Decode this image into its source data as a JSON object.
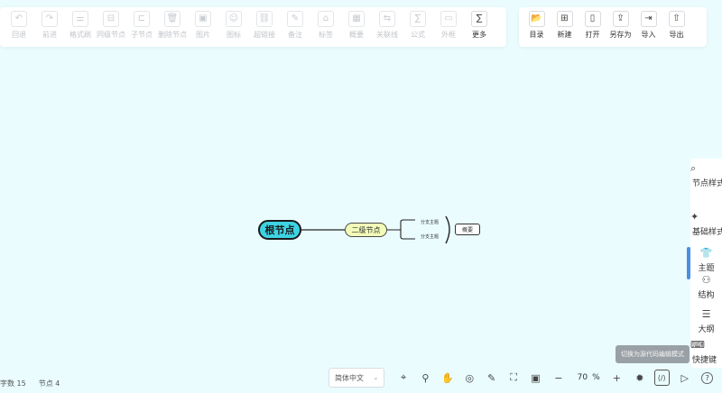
{
  "toolbar_left": [
    {
      "name": "undo",
      "label": "回退",
      "icon": "↶",
      "enabled": false
    },
    {
      "name": "redo",
      "label": "前进",
      "icon": "↷",
      "enabled": false
    },
    {
      "name": "format-painter",
      "label": "格式刷",
      "icon": "⚌",
      "enabled": false
    },
    {
      "name": "sibling-node",
      "label": "同级节点",
      "icon": "⊟",
      "enabled": false
    },
    {
      "name": "child-node",
      "label": "子节点",
      "icon": "⊏",
      "enabled": false
    },
    {
      "name": "delete-node",
      "label": "删除节点",
      "icon": "🗑",
      "enabled": false
    },
    {
      "name": "image",
      "label": "图片",
      "icon": "▣",
      "enabled": false
    },
    {
      "name": "icon",
      "label": "图标",
      "icon": "☺",
      "enabled": false
    },
    {
      "name": "hyperlink",
      "label": "超链接",
      "icon": "⛓",
      "enabled": false
    },
    {
      "name": "note",
      "label": "备注",
      "icon": "✎",
      "enabled": false
    },
    {
      "name": "tag",
      "label": "标签",
      "icon": "⌂",
      "enabled": false
    },
    {
      "name": "summary",
      "label": "概要",
      "icon": "▦",
      "enabled": false
    },
    {
      "name": "relation-line",
      "label": "关联线",
      "icon": "⇆",
      "enabled": false
    },
    {
      "name": "formula",
      "label": "公式",
      "icon": "∑",
      "enabled": false
    },
    {
      "name": "outer-frame",
      "label": "外框",
      "icon": "▭",
      "enabled": false
    },
    {
      "name": "more",
      "label": "更多",
      "icon": "∑",
      "enabled": true
    }
  ],
  "toolbar_right": [
    {
      "name": "directory",
      "label": "目录",
      "icon": "📂"
    },
    {
      "name": "new",
      "label": "新建",
      "icon": "⊞"
    },
    {
      "name": "open",
      "label": "打开",
      "icon": "▯"
    },
    {
      "name": "save-as",
      "label": "另存为",
      "icon": "⇪"
    },
    {
      "name": "import",
      "label": "导入",
      "icon": "⇥"
    },
    {
      "name": "export",
      "label": "导出",
      "icon": "⇧"
    }
  ],
  "mindmap": {
    "root": "根节点",
    "second": "二级节点",
    "branches": [
      "分支主题",
      "分支主题"
    ],
    "summary": "概要"
  },
  "side_panel": [
    {
      "name": "node-style",
      "label": "节点样式",
      "icon": "⌕"
    },
    {
      "name": "base-style",
      "label": "基础样式",
      "icon": "✦"
    },
    {
      "name": "theme",
      "label": "主题",
      "icon": "👕"
    },
    {
      "name": "structure",
      "label": "结构",
      "icon": "⚇"
    },
    {
      "name": "outline",
      "label": "大纲",
      "icon": "☰"
    },
    {
      "name": "shortcuts",
      "label": "快捷键",
      "icon": "⌨"
    }
  ],
  "tooltip": "切换为源代码编辑模式",
  "status": {
    "word_label": "字数",
    "word_count": "15",
    "node_label": "节点",
    "node_count": "4"
  },
  "bottom_bar": {
    "language": "简体中文",
    "zoom": "70",
    "zoom_unit": "%"
  }
}
